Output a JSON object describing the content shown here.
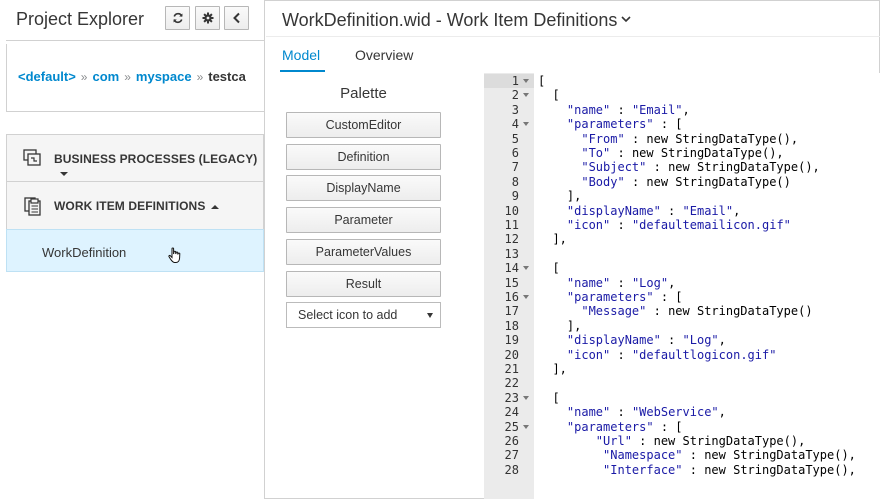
{
  "left_panel": {
    "title": "Project Explorer",
    "header_buttons": [
      "refresh-icon",
      "gear-icon",
      "chevron-left-icon"
    ],
    "breadcrumb": [
      {
        "label": "<default>",
        "link": true
      },
      {
        "label": "com",
        "link": true
      },
      {
        "label": "myspace",
        "link": true
      },
      {
        "label": "testca",
        "link": false
      }
    ],
    "breadcrumb_separator": "»",
    "sections": [
      {
        "label": "BUSINESS PROCESSES (LEGACY)",
        "icon": "business-process-icon",
        "expanded": false
      },
      {
        "label": "WORK ITEM DEFINITIONS",
        "icon": "work-item-icon",
        "expanded": true
      }
    ],
    "items": [
      {
        "label": "WorkDefinition",
        "selected": true
      }
    ]
  },
  "editor": {
    "title": "WorkDefinition.wid - Work Item Definitions",
    "tabs": [
      {
        "label": "Model",
        "active": true
      },
      {
        "label": "Overview",
        "active": false
      }
    ]
  },
  "palette": {
    "title": "Palette",
    "buttons": [
      "CustomEditor",
      "Definition",
      "DisplayName",
      "Parameter",
      "ParameterValues",
      "Result"
    ],
    "select_placeholder": "Select icon to add"
  },
  "code": {
    "active_line": 1,
    "lines": [
      {
        "n": "1",
        "fold": true,
        "text": "["
      },
      {
        "n": "2",
        "fold": true,
        "text": "  ["
      },
      {
        "n": "3",
        "fold": false,
        "text": "    \"name\" : \"Email\","
      },
      {
        "n": "4",
        "fold": true,
        "text": "    \"parameters\" : ["
      },
      {
        "n": "5",
        "fold": false,
        "text": "      \"From\" : new StringDataType(),"
      },
      {
        "n": "6",
        "fold": false,
        "text": "      \"To\" : new StringDataType(),"
      },
      {
        "n": "7",
        "fold": false,
        "text": "      \"Subject\" : new StringDataType(),"
      },
      {
        "n": "8",
        "fold": false,
        "text": "      \"Body\" : new StringDataType()"
      },
      {
        "n": "9",
        "fold": false,
        "text": "    ],"
      },
      {
        "n": "10",
        "fold": false,
        "text": "    \"displayName\" : \"Email\","
      },
      {
        "n": "11",
        "fold": false,
        "text": "    \"icon\" : \"defaultemailicon.gif\""
      },
      {
        "n": "12",
        "fold": false,
        "text": "  ],"
      },
      {
        "n": "13",
        "fold": false,
        "text": ""
      },
      {
        "n": "14",
        "fold": true,
        "text": "  ["
      },
      {
        "n": "15",
        "fold": false,
        "text": "    \"name\" : \"Log\","
      },
      {
        "n": "16",
        "fold": true,
        "text": "    \"parameters\" : ["
      },
      {
        "n": "17",
        "fold": false,
        "text": "      \"Message\" : new StringDataType()"
      },
      {
        "n": "18",
        "fold": false,
        "text": "    ],"
      },
      {
        "n": "19",
        "fold": false,
        "text": "    \"displayName\" : \"Log\","
      },
      {
        "n": "20",
        "fold": false,
        "text": "    \"icon\" : \"defaultlogicon.gif\""
      },
      {
        "n": "21",
        "fold": false,
        "text": "  ],"
      },
      {
        "n": "22",
        "fold": false,
        "text": ""
      },
      {
        "n": "23",
        "fold": true,
        "text": "  ["
      },
      {
        "n": "24",
        "fold": false,
        "text": "    \"name\" : \"WebService\","
      },
      {
        "n": "25",
        "fold": true,
        "text": "    \"parameters\" : ["
      },
      {
        "n": "26",
        "fold": false,
        "text": "        \"Url\" : new StringDataType(),"
      },
      {
        "n": "27",
        "fold": false,
        "text": "         \"Namespace\" : new StringDataType(),"
      },
      {
        "n": "28",
        "fold": false,
        "text": "         \"Interface\" : new StringDataType(),"
      }
    ]
  }
}
